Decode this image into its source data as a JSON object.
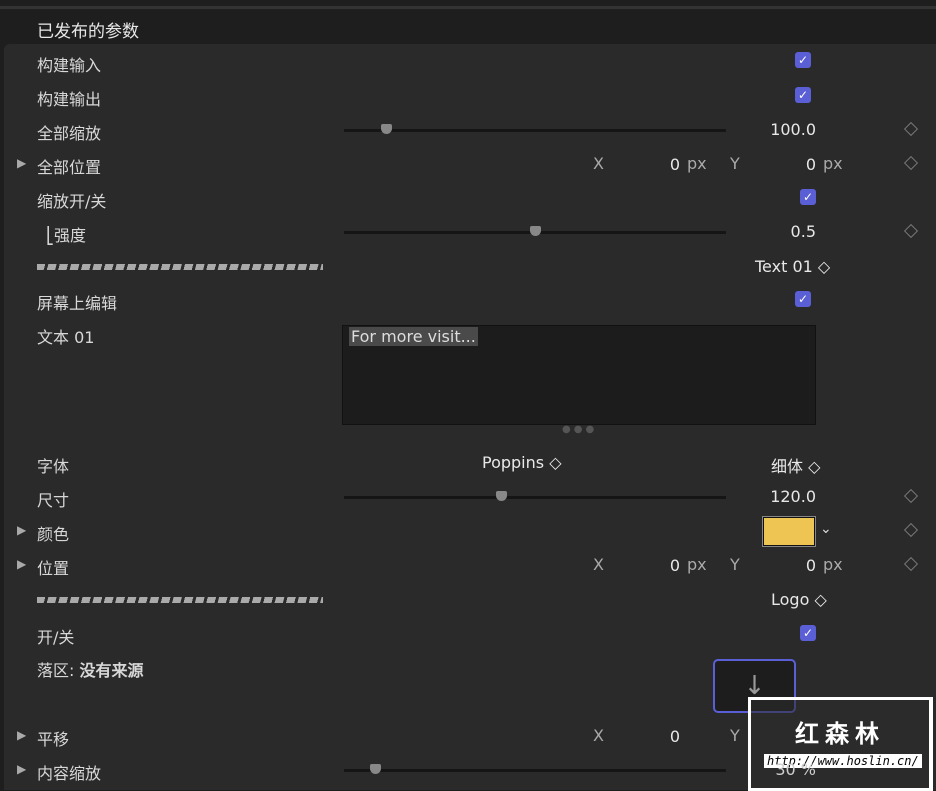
{
  "header": {
    "title": "已发布的参数"
  },
  "rows": {
    "build_in": {
      "label": "构建输入",
      "checked": true
    },
    "build_out": {
      "label": "构建输出",
      "checked": true
    },
    "scale_all": {
      "label": "全部缩放",
      "value": "100.0",
      "slider_fraction": 0.1
    },
    "pos_all": {
      "label": "全部位置",
      "x_label": "X",
      "x": "0",
      "x_unit": "px",
      "y_label": "Y",
      "y": "0",
      "y_unit": "px"
    },
    "scale_toggle": {
      "label": "缩放开/关",
      "checked": true
    },
    "strength": {
      "label": "⎣强度",
      "value": "0.5",
      "slider_fraction": 0.5
    },
    "group1": {
      "selector": "Text 01 ◇"
    },
    "onscreen_edit": {
      "label": "屏幕上编辑",
      "checked": true
    },
    "text01": {
      "label": "文本 01",
      "value": "For more visit..."
    },
    "font": {
      "label": "字体",
      "family": "Poppins",
      "weight": "细体"
    },
    "size": {
      "label": "尺寸",
      "value": "120.0",
      "slider_fraction": 0.4
    },
    "color": {
      "label": "颜色",
      "swatch": "#eec553"
    },
    "position": {
      "label": "位置",
      "x_label": "X",
      "x": "0",
      "x_unit": "px",
      "y_label": "Y",
      "y": "0",
      "y_unit": "px"
    },
    "group2": {
      "selector": "Logo ◇"
    },
    "onoff": {
      "label": "开/关",
      "checked": true
    },
    "drop_zone": {
      "label": "落区:",
      "source": "没有来源"
    },
    "pan": {
      "label": "平移",
      "x_label": "X",
      "x": "0",
      "y_label": "Y"
    },
    "content_scale": {
      "label": "内容缩放",
      "value": "30 %",
      "slider_fraction": 0.08
    }
  },
  "watermark": {
    "title": "红森林",
    "url": "http://www.hoslin.cn/"
  }
}
